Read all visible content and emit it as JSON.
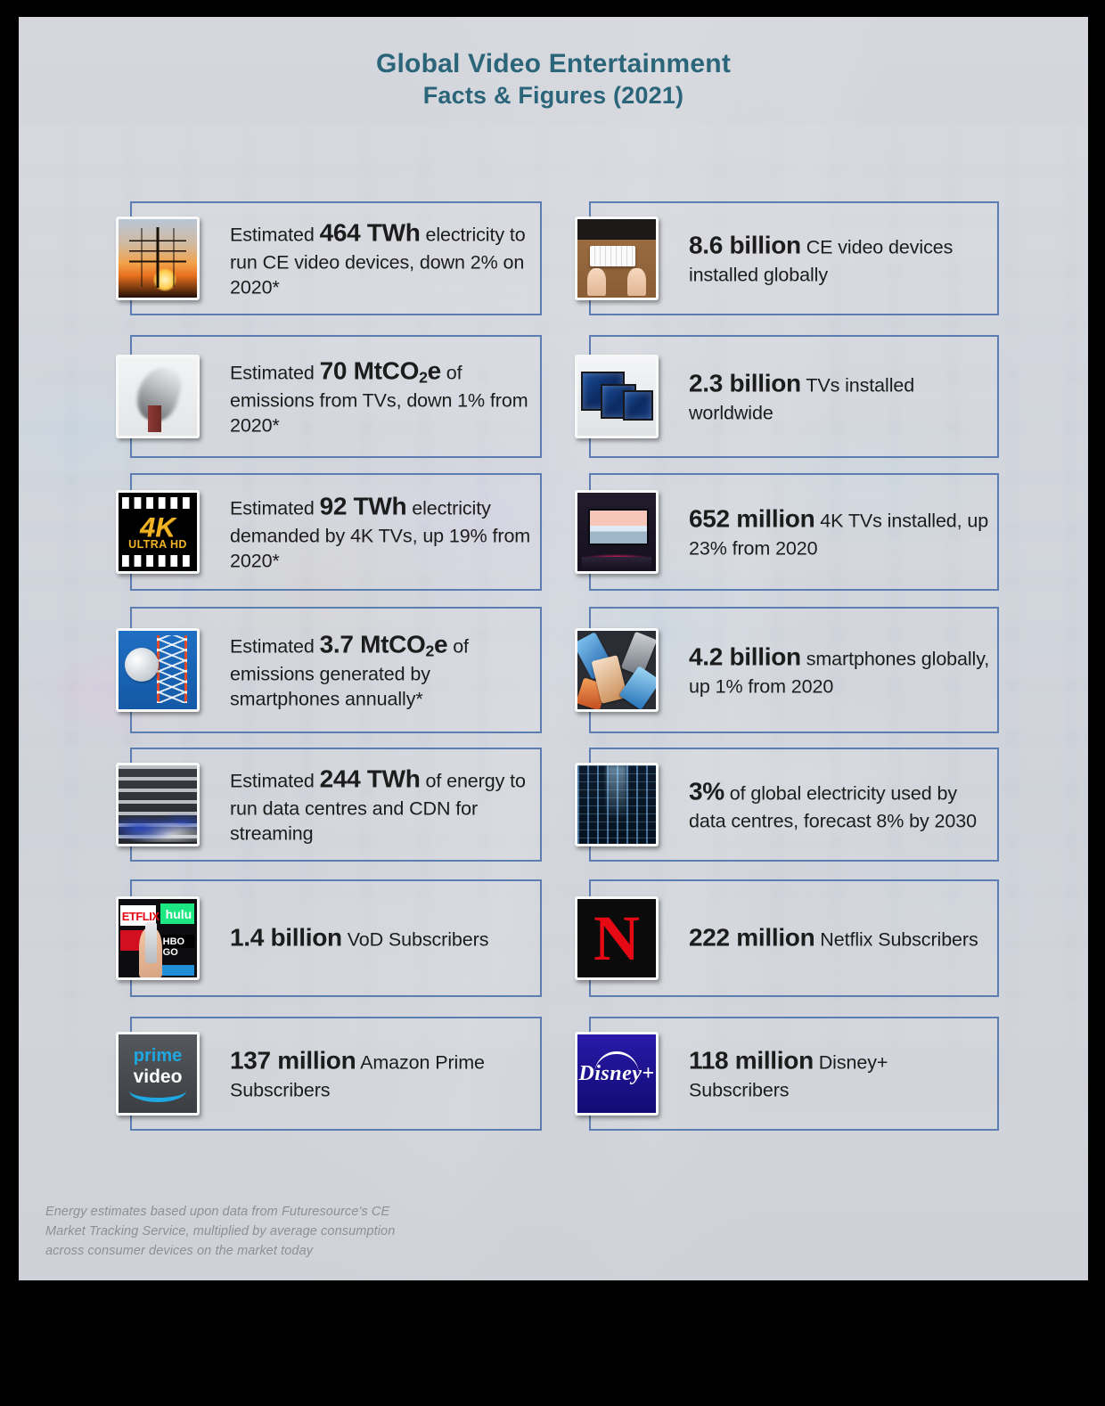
{
  "title": {
    "line1": "Global Video Entertainment",
    "line2": "Facts & Figures (2021)",
    "color": "#2b6579"
  },
  "theme": {
    "card_border": "#5c7db1",
    "body_text": "#1c1c1c",
    "footnote_text": "#8d9096",
    "plate_background": "#cdd1d8"
  },
  "cards": {
    "left": [
      {
        "icon": "electricity-pylon-icon",
        "lead": "Estimated ",
        "value": "464 TWh",
        "rest": "",
        "tail": "electricity to run CE video devices, down 2% on 2020*"
      },
      {
        "icon": "smokestack-emissions-icon",
        "lead": "Estimated ",
        "value": "70 MtCO",
        "sub": "2",
        "value_end": "e",
        "rest": " of",
        "tail": "emissions from TVs, down 1% from 2020*"
      },
      {
        "icon": "4k-ultra-hd-icon",
        "lead": "Estimated ",
        "value": "92 TWh",
        "rest": "",
        "tail": "electricity demanded by 4K TVs, up 19% from 2020*"
      },
      {
        "icon": "satellite-mast-icon",
        "lead": "Estimated ",
        "value": "3.7 MtCO",
        "sub": "2",
        "value_end": "e",
        "rest": " of",
        "tail": "emissions generated by smartphones annually*"
      },
      {
        "icon": "server-rack-icon",
        "lead": "Estimated ",
        "value": "244 TWh",
        "rest": " of",
        "tail": "energy to run data centres and CDN for streaming"
      },
      {
        "icon": "streaming-apps-icon",
        "lead": "",
        "value": "1.4 billion",
        "rest": "",
        "tail": "VoD Subscribers"
      },
      {
        "icon": "amazon-prime-video-icon",
        "lead": "",
        "value": "137 million",
        "rest": " Amazon Prime",
        "tail": "Subscribers"
      }
    ],
    "right": [
      {
        "icon": "desk-keyboard-icon",
        "lead": "",
        "value": "8.6 billion",
        "rest": " CE video devices",
        "tail": "installed globally"
      },
      {
        "icon": "television-set-icon",
        "lead": "",
        "value": "2.3 billion",
        "rest": " TVs installed",
        "tail": "worldwide"
      },
      {
        "icon": "4k-living-room-tv-icon",
        "lead": "",
        "value": "652 million",
        "rest": "",
        "tail": "4K TVs installed, up 23% from 2020"
      },
      {
        "icon": "smartphone-pile-icon",
        "lead": "",
        "value": "4.2 billion",
        "rest": " smartphones",
        "tail": "globally, up 1% from 2020"
      },
      {
        "icon": "data-centre-icon",
        "lead": "",
        "value": "3%",
        "rest": " of global electricity used",
        "tail": "by data centres, forecast 8% by 2030"
      },
      {
        "icon": "netflix-icon",
        "lead": "",
        "value": "222 million",
        "rest": "",
        "tail": "Netflix Subscribers"
      },
      {
        "icon": "disney-plus-icon",
        "lead": "",
        "value": "118 million",
        "rest": "",
        "tail": "Disney+ Subscribers"
      }
    ]
  },
  "footnote": {
    "marker": "*",
    "line1": "Energy estimates based upon data from Futuresource's CE",
    "line2": "Market Tracking Service, multiplied by average consumption",
    "line3": "across consumer devices on the market today"
  },
  "icon_labels": {
    "4k_badge_big": "4K",
    "4k_badge_small": "ULTRA HD",
    "netflix_mark": "N",
    "prime_word1": "prime",
    "prime_word2": "video",
    "disney_mark": "Disney+"
  }
}
